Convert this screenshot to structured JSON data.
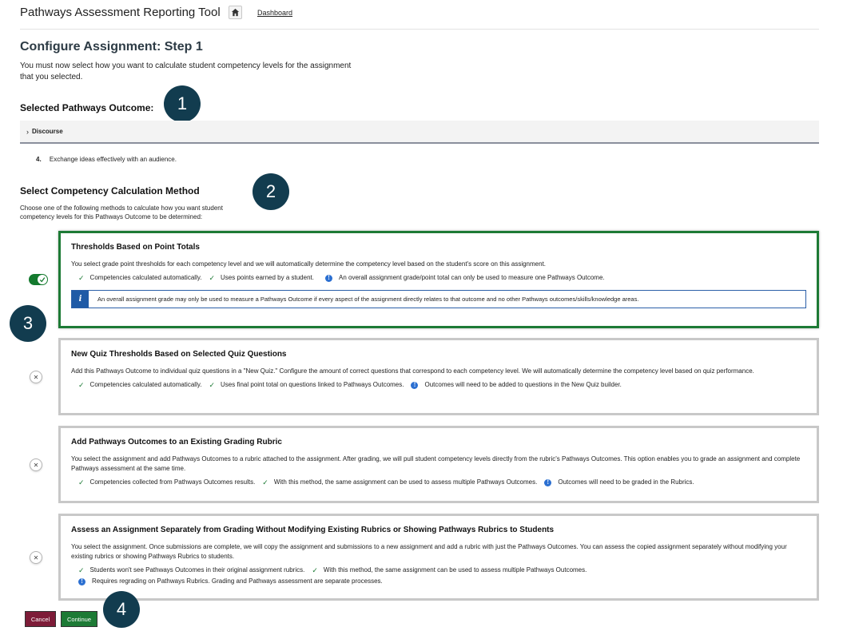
{
  "app": {
    "title": "Pathways Assessment Reporting Tool",
    "dashboard_link": "Dashboard"
  },
  "page": {
    "title": "Configure Assignment: Step 1",
    "description": "You must now select how you want to calculate student competency levels for the assignment that you selected."
  },
  "outcome": {
    "heading": "Selected Pathways Outcome:",
    "accordion_label": "Discourse",
    "item_number": "4.",
    "item_text": "Exchange ideas effectively with an audience."
  },
  "calc": {
    "heading": "Select Competency Calculation Method",
    "description": "Choose one of the following methods to calculate how you want student competency levels for this Pathways Outcome to be determined:"
  },
  "callouts": [
    "1",
    "2",
    "3",
    "4"
  ],
  "methods": [
    {
      "title": "Thresholds Based on Point Totals",
      "selected": true,
      "description": "You select grade point thresholds for each competency level and we will automatically determine the competency level based on the student's score on this assignment.",
      "pros": [
        "Competencies calculated automatically.",
        "Uses points earned by a student."
      ],
      "notes": [
        "An overall assignment grade/point total can only be used to measure one Pathways Outcome."
      ],
      "alert": "An overall assignment grade may only be used to measure a Pathways Outcome if every aspect of the assignment directly relates to that outcome and no other Pathways outcomes/skills/knowledge areas."
    },
    {
      "title": "New Quiz Thresholds Based on Selected Quiz Questions",
      "selected": false,
      "description": "Add this Pathways Outcome to individual quiz questions in a \"New Quiz.\" Configure the amount of correct questions that correspond to each competency level. We will automatically determine the competency level based on quiz performance.",
      "pros": [
        "Competencies calculated automatically.",
        "Uses final point total on questions linked to Pathways Outcomes."
      ],
      "notes": [
        "Outcomes will need to be added to questions in the New Quiz builder."
      ]
    },
    {
      "title": "Add Pathways Outcomes to an Existing Grading Rubric",
      "selected": false,
      "description": "You select the assignment and add Pathways Outcomes to a rubric attached to the assignment. After grading, we will pull student competency levels directly from the rubric's Pathways Outcomes. This option enables you to grade an assignment and complete Pathways assessment at the same time.",
      "pros": [
        "Competencies collected from Pathways Outcomes results.",
        "With this method, the same assignment can be used to assess multiple Pathways Outcomes."
      ],
      "notes": [
        "Outcomes will need to be graded in the Rubrics."
      ]
    },
    {
      "title": "Assess an Assignment Separately from Grading Without Modifying Existing Rubrics or Showing Pathways Rubrics to Students",
      "selected": false,
      "description": "You select the assignment. Once submissions are complete, we will copy the assignment and submissions to a new assignment and add a rubric with just the Pathways Outcomes. You can assess the copied assignment separately without modifying your existing rubrics or showing Pathways Rubrics to students.",
      "pros": [
        "Students won't see Pathways Outcomes in their original assignment rubrics.",
        "With this method, the same assignment can be used to assess multiple Pathways Outcomes."
      ],
      "notes": [
        "Requires regrading on Pathways Rubrics. Grading and Pathways assessment are separate processes."
      ]
    }
  ],
  "buttons": {
    "cancel": "Cancel",
    "continue": "Continue"
  },
  "colors": {
    "selected_border": "#1d7a35",
    "callout": "#123c4f",
    "cancel": "#7d1c38",
    "continue": "#1d7a35",
    "info": "#2b6fd1"
  },
  "icons": {
    "home": "home-icon",
    "check": "check-icon",
    "info": "info-icon",
    "close": "close-icon",
    "chevron": "chevron-right-icon"
  }
}
